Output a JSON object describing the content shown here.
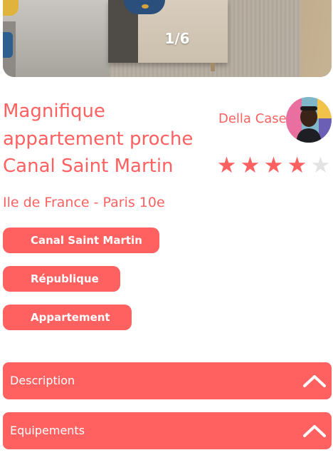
{
  "colors": {
    "accent": "#ff6060",
    "star_filled": "#ff6060",
    "star_empty": "#e3e3e3",
    "text_on_accent": "#ffffff"
  },
  "gallery": {
    "counter": "1/6",
    "current_image": 1,
    "total_images": 6
  },
  "listing": {
    "title": "Magnifique appartement proche Canal Saint Martin",
    "location": "Ile de France - Paris 10e",
    "tags": [
      "Canal Saint Martin",
      "République",
      "Appartement"
    ]
  },
  "host": {
    "name": "Della Case",
    "avatar_icon": "host-avatar-photo"
  },
  "rating": {
    "value": 4,
    "max": 5
  },
  "sections": [
    {
      "label": "Description",
      "icon": "chevron-up-icon"
    },
    {
      "label": "Equipements",
      "icon": "chevron-up-icon"
    }
  ]
}
